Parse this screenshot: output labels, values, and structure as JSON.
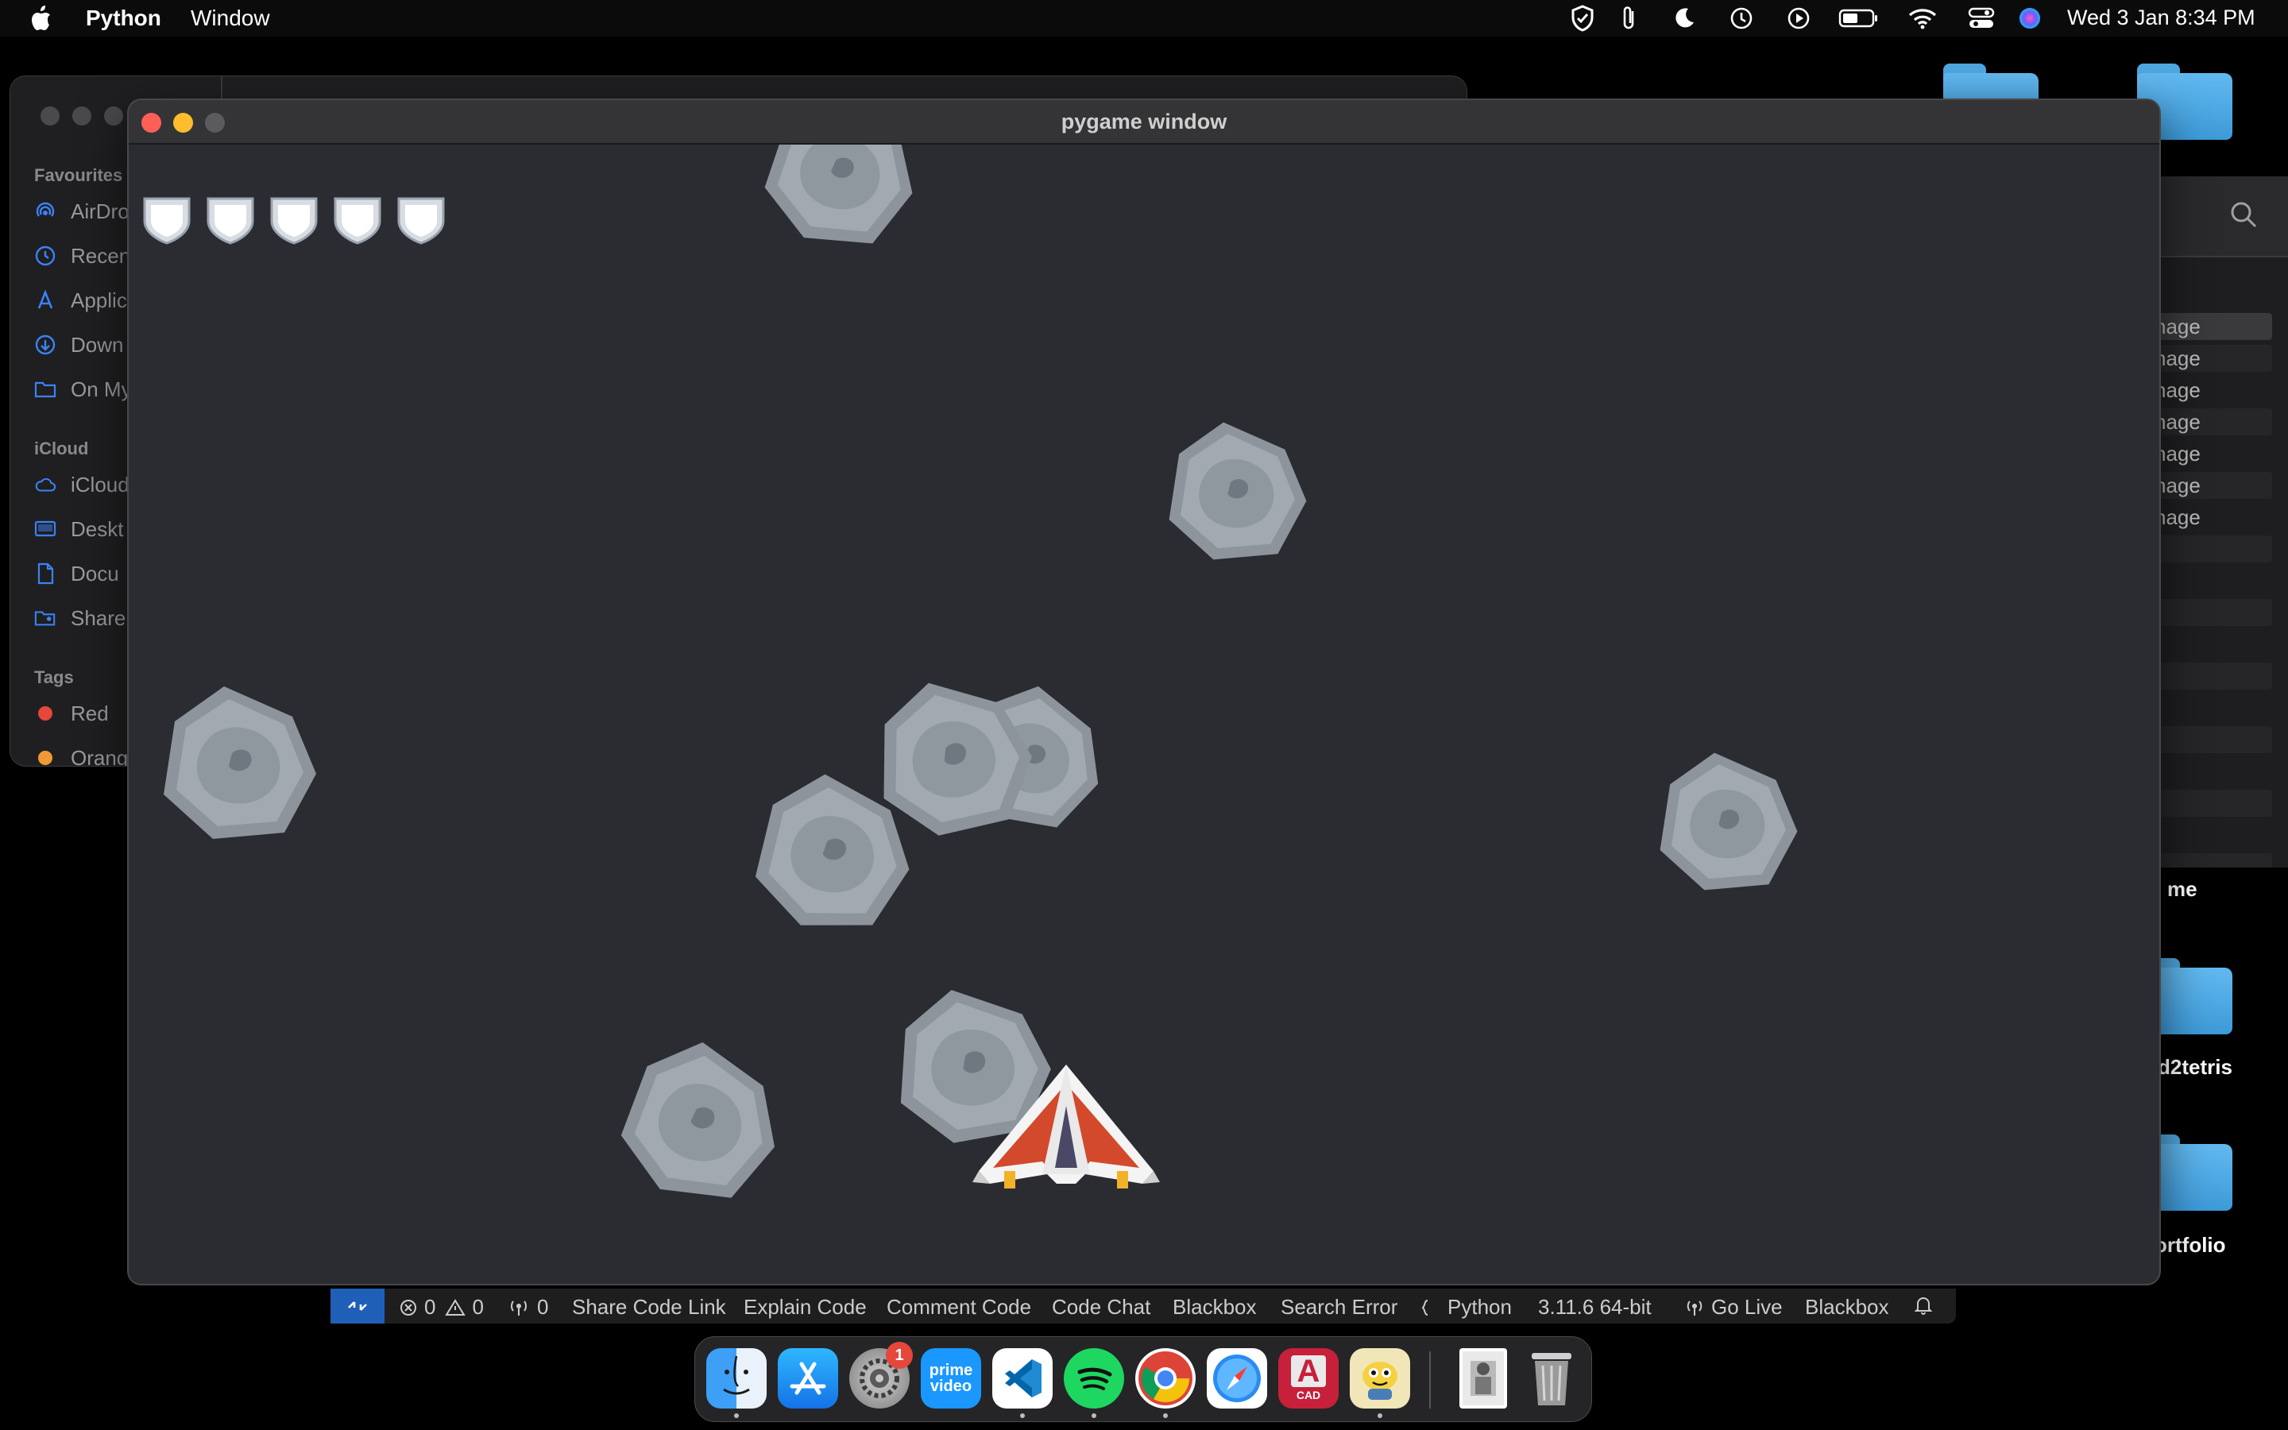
{
  "menubar": {
    "app_name": "Python",
    "menu_window": "Window",
    "clock": "Wed 3 Jan  8:34 PM"
  },
  "finder": {
    "section_favourites": "Favourites",
    "section_icloud": "iCloud",
    "section_tags": "Tags",
    "favourites": [
      "AirDro",
      "Recen",
      "Applic",
      "Down",
      "On My"
    ],
    "icloud": [
      "iCloud",
      "Deskt",
      "Docu",
      "Share"
    ],
    "tags": [
      {
        "label": "Red",
        "color": "#e5473b"
      },
      {
        "label": "Orang",
        "color": "#f09a35"
      }
    ]
  },
  "finder_right": {
    "rows": [
      "nage",
      "nage",
      "nage",
      "nage",
      "nage",
      "nage",
      "nage"
    ]
  },
  "desktop": {
    "folders": [
      {
        "label": "me"
      },
      {
        "label": "d2tetris"
      },
      {
        "label": "ortfolio"
      }
    ]
  },
  "pygame": {
    "title": "pygame window",
    "lives": 5,
    "background": "#2a2c31"
  },
  "statusbar": {
    "errors": "0",
    "warnings": "0",
    "ports": "0",
    "share_code_link": "Share Code Link",
    "explain_code": "Explain Code",
    "comment_code": "Comment Code",
    "code_chat": "Code Chat",
    "blackbox": "Blackbox",
    "search_error": "Search Error",
    "language": "Python",
    "interpreter": "3.11.6 64-bit",
    "go_live": "Go Live",
    "blackbox2": "Blackbox"
  },
  "dock": {
    "apps": [
      {
        "name": "Finder",
        "running": true
      },
      {
        "name": "App Store",
        "running": false
      },
      {
        "name": "System Settings",
        "running": false,
        "badge": "1"
      },
      {
        "name": "prime video",
        "running": false
      },
      {
        "name": "Visual Studio Code",
        "running": true
      },
      {
        "name": "Spotify",
        "running": true
      },
      {
        "name": "Google Chrome",
        "running": true
      },
      {
        "name": "Safari",
        "running": false
      },
      {
        "name": "CAD",
        "running": false
      },
      {
        "name": "Python Launcher",
        "running": true
      }
    ],
    "prime_text_1": "prime",
    "prime_text_2": "video",
    "cad_letter": "A",
    "cad_text": "CAD"
  }
}
